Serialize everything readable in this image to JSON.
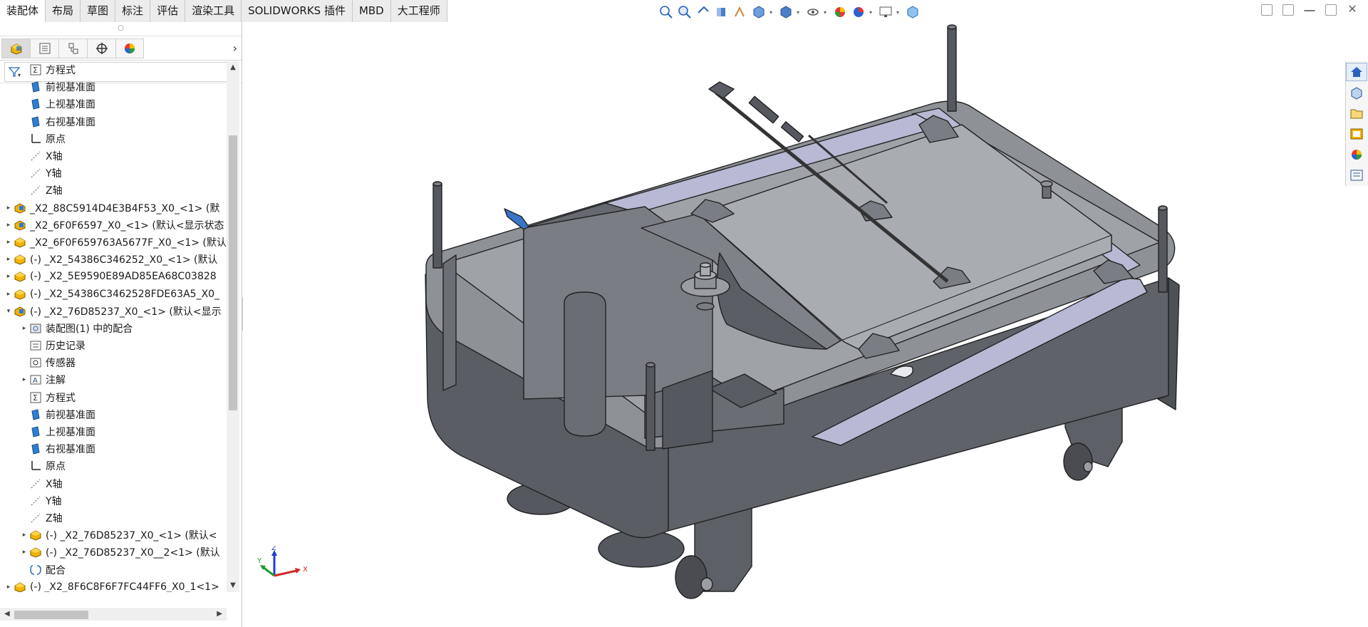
{
  "command_tabs": [
    "装配体",
    "布局",
    "草图",
    "标注",
    "评估",
    "渲染工具",
    "SOLIDWORKS 插件",
    "MBD",
    "大工程师"
  ],
  "active_tab_index": 0,
  "hud_toolbar": {
    "icons": [
      "zoom-to-fit-icon",
      "zoom-area-icon",
      "previous-view-icon",
      "section-view-icon",
      "dynamic-annotation-icon",
      "view-orientation-icon",
      "display-style-icon",
      "hide-show-icon",
      "edit-appearance-icon",
      "apply-scene-icon",
      "view-settings-icon",
      "3d-view-icon"
    ]
  },
  "panel_tabs": [
    "feature-manager-icon",
    "property-manager-icon",
    "configuration-manager-icon",
    "dimxpert-manager-icon",
    "display-manager-icon"
  ],
  "feature_tree": [
    {
      "label": "方程式",
      "icon": "equations-icon",
      "indent": 1,
      "expander": ""
    },
    {
      "label": "前视基准面",
      "icon": "plane-icon",
      "indent": 1,
      "expander": ""
    },
    {
      "label": "上视基准面",
      "icon": "plane-icon",
      "indent": 1,
      "expander": ""
    },
    {
      "label": "右视基准面",
      "icon": "plane-icon",
      "indent": 1,
      "expander": ""
    },
    {
      "label": "原点",
      "icon": "origin-icon",
      "indent": 1,
      "expander": ""
    },
    {
      "label": "X轴",
      "icon": "axis-icon",
      "indent": 1,
      "expander": ""
    },
    {
      "label": "Y轴",
      "icon": "axis-icon",
      "indent": 1,
      "expander": ""
    },
    {
      "label": "Z轴",
      "icon": "axis-icon",
      "indent": 1,
      "expander": ""
    },
    {
      "label": "_X2_88C5914D4E3B4F53_X0_<1> (默",
      "icon": "assembly-icon",
      "indent": 0,
      "expander": "▸"
    },
    {
      "label": "_X2_6F0F6597_X0_<1> (默认<显示状态",
      "icon": "assembly-icon",
      "indent": 0,
      "expander": "▸"
    },
    {
      "label": "_X2_6F0F659763A5677F_X0_<1> (默认",
      "icon": "part-icon",
      "indent": 0,
      "expander": "▸"
    },
    {
      "label": "(-) _X2_54386C346252_X0_<1> (默认",
      "icon": "part-icon",
      "indent": 0,
      "expander": "▸"
    },
    {
      "label": "(-) _X2_5E9590E89AD85EA68C03828",
      "icon": "part-icon",
      "indent": 0,
      "expander": "▸"
    },
    {
      "label": "(-) _X2_54386C3462528FDE63A5_X0_",
      "icon": "part-icon",
      "indent": 0,
      "expander": "▸"
    },
    {
      "label": "(-) _X2_76D85237_X0_<1> (默认<显示",
      "icon": "assembly-icon",
      "indent": 0,
      "expander": "▾"
    },
    {
      "label": "装配图(1) 中的配合",
      "icon": "mates-folder-icon",
      "indent": 1,
      "expander": "▸"
    },
    {
      "label": "历史记录",
      "icon": "history-icon",
      "indent": 1,
      "expander": ""
    },
    {
      "label": "传感器",
      "icon": "sensor-icon",
      "indent": 1,
      "expander": ""
    },
    {
      "label": "注解",
      "icon": "annotations-icon",
      "indent": 1,
      "expander": "▸"
    },
    {
      "label": "方程式",
      "icon": "equations-icon",
      "indent": 1,
      "expander": ""
    },
    {
      "label": "前视基准面",
      "icon": "plane-icon",
      "indent": 1,
      "expander": ""
    },
    {
      "label": "上视基准面",
      "icon": "plane-icon",
      "indent": 1,
      "expander": ""
    },
    {
      "label": "右视基准面",
      "icon": "plane-icon",
      "indent": 1,
      "expander": ""
    },
    {
      "label": "原点",
      "icon": "origin-icon",
      "indent": 1,
      "expander": ""
    },
    {
      "label": "X轴",
      "icon": "axis-icon",
      "indent": 1,
      "expander": ""
    },
    {
      "label": "Y轴",
      "icon": "axis-icon",
      "indent": 1,
      "expander": ""
    },
    {
      "label": "Z轴",
      "icon": "axis-icon",
      "indent": 1,
      "expander": ""
    },
    {
      "label": "(-) _X2_76D85237_X0_<1> (默认<",
      "icon": "part-icon",
      "indent": 1,
      "expander": "▸"
    },
    {
      "label": "(-) _X2_76D85237_X0__2<1> (默认",
      "icon": "part-icon",
      "indent": 1,
      "expander": "▸"
    },
    {
      "label": "配合",
      "icon": "mates-icon",
      "indent": 1,
      "expander": ""
    },
    {
      "label": "(-) _X2_8F6C8F6F7FC44FF6_X0_1<1>",
      "icon": "part-icon",
      "indent": 0,
      "expander": "▸"
    }
  ],
  "triad": {
    "x": "X",
    "y": "Y",
    "z": "Z"
  },
  "task_pane": [
    "home-icon",
    "design-library-icon",
    "file-explorer-icon",
    "view-palette-icon",
    "appearances-icon",
    "custom-properties-icon"
  ],
  "colors": {
    "accent": "#0a64c8",
    "model_dark": "#5d6066",
    "model_top": "#9a9da2",
    "model_light": "#b8b9d4"
  }
}
